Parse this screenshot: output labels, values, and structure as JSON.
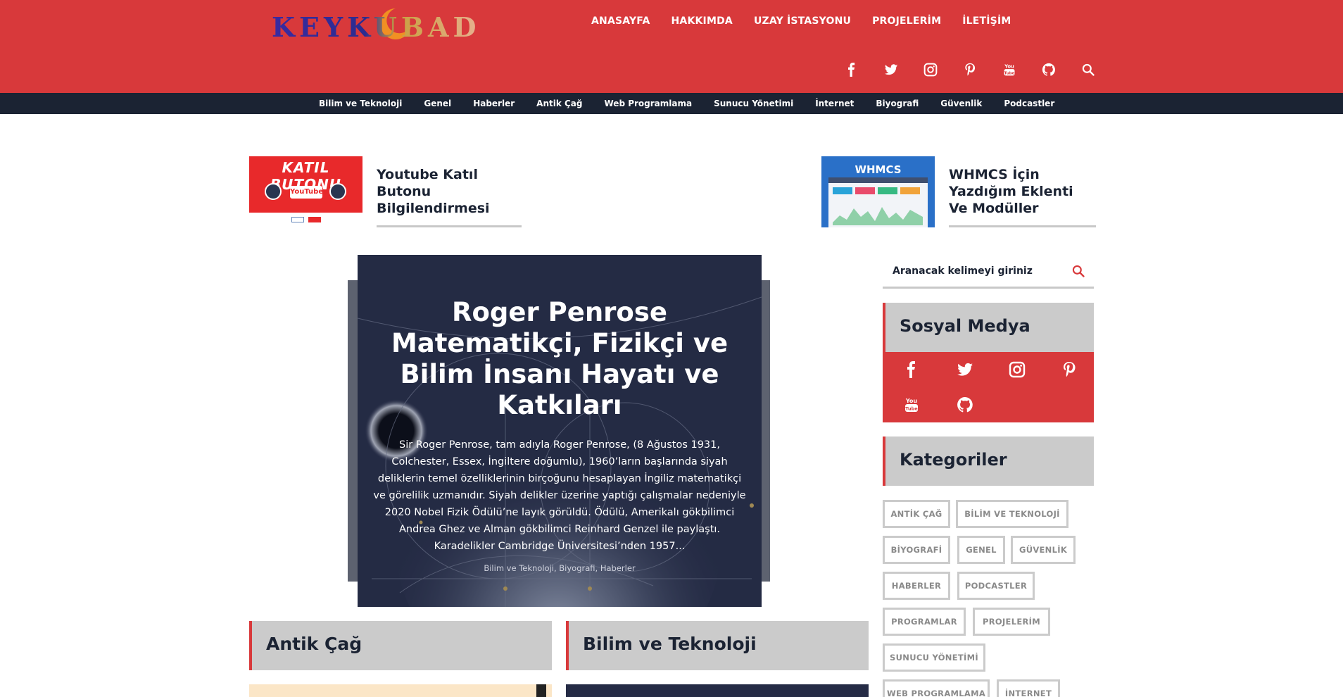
{
  "header": {
    "logo_text": "KEYKUBAD",
    "nav": [
      "ANASAYFA",
      "HAKKIMDA",
      "UZAY İSTASYONU",
      "PROJELERİM",
      "İLETİŞİM"
    ],
    "social_icons": [
      "facebook-icon",
      "twitter-icon",
      "instagram-icon",
      "pinterest-icon",
      "youtube-icon",
      "github-icon",
      "search-icon"
    ]
  },
  "category_bar": [
    "Bilim ve Teknoloji",
    "Genel",
    "Haberler",
    "Antik Çağ",
    "Web Programlama",
    "Sunucu Yönetimi",
    "İnternet",
    "Biyografi",
    "Güvenlik",
    "Podcastler"
  ],
  "featured": [
    {
      "title": "Youtube Katıl Butonu Bilgilendirmesi",
      "thumb_text": "KATIL BUTONU",
      "thumb_sub": "YouTube"
    },
    {
      "title": "WHMCS İçin Yazdığım Eklenti Ve Modüller",
      "thumb_text": "WHMCS"
    }
  ],
  "hero": {
    "title": "Roger Penrose Matematikçi, Fizikçi ve Bilim İnsanı Hayatı ve Katkıları",
    "excerpt": "Sir Roger Penrose, tam adıyla Roger Penrose, (8 Ağustos 1931, Colchester, Essex, İngiltere doğumlu), 1960’ların başlarında siyah deliklerin temel özelliklerinin birçoğunu hesaplayan İngiliz matematikçi ve görelilik uzmanıdır. Siyah delikler üzerine yaptığı çalışmalar nedeniyle 2020 Nobel Fizik Ödülü’ne layık görüldü. Ödülü, Amerikalı gökbilimci Andrea Ghez ve Alman gökbilimci Reinhard Genzel ile paylaştı. Karadelikler Cambridge Üniversitesi’nden 1957...",
    "categories": "Bilim ve Teknoloji, Biyografi, Haberler"
  },
  "sections": [
    "Antik Çağ",
    "Bilim ve Teknoloji"
  ],
  "sidebar": {
    "search_placeholder": "Aranacak kelimeyi giriniz",
    "social_title": "Sosyal Medya",
    "social_icons": [
      "facebook-icon",
      "twitter-icon",
      "instagram-icon",
      "pinterest-icon",
      "youtube-icon",
      "github-icon"
    ],
    "categories_title": "Kategoriler",
    "tags": [
      "ANTİK ÇAĞ",
      "BİLİM VE TEKNOLOJİ",
      "BİYOGRAFİ",
      "GENEL",
      "GÜVENLİK",
      "HABERLER",
      "PODCASTLER",
      "PROGRAMLAR",
      "PROJELERİM",
      "SUNUCU YÖNETİMİ",
      "WEB PROGRAMLAMA",
      "İNTERNET"
    ]
  },
  "colors": {
    "brand_red": "#d8393b",
    "navy": "#1b2333",
    "panel_grey": "#cbcbcb"
  }
}
